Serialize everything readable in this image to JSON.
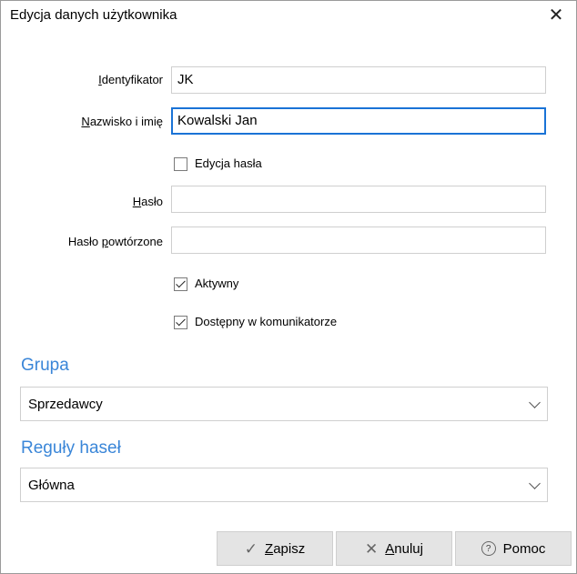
{
  "window": {
    "title": "Edycja danych użytkownika",
    "close_glyph": "✕"
  },
  "fields": {
    "identifier": {
      "label_u": "I",
      "label_rest": "dentyfikator",
      "value": "JK"
    },
    "name": {
      "label_u": "N",
      "label_rest": "azwisko i imię",
      "value": "Kowalski Jan"
    },
    "edit_password": {
      "label": "Edycja hasła",
      "checked": false
    },
    "password": {
      "label_u": "H",
      "label_rest": "asło",
      "value": ""
    },
    "password_repeat": {
      "label_pre": "Hasło ",
      "label_u": "p",
      "label_rest": "owtórzone",
      "value": ""
    },
    "active": {
      "label": "Aktywny",
      "checked": true
    },
    "messenger": {
      "label": "Dostępny w komunikatorze",
      "checked": true
    }
  },
  "group": {
    "header": "Grupa",
    "selected": "Sprzedawcy"
  },
  "password_rules": {
    "header": "Reguły haseł",
    "selected": "Główna"
  },
  "buttons": {
    "save": {
      "icon": "check-icon",
      "glyph": "✓",
      "label_u": "Z",
      "label_rest": "apisz"
    },
    "cancel": {
      "icon": "close-icon",
      "glyph": "✕",
      "label_u": "A",
      "label_rest": "nuluj"
    },
    "help": {
      "icon": "question-circle-icon",
      "glyph": "?",
      "label": "Pomoc"
    }
  },
  "colors": {
    "accent": "#3a86d8",
    "focus_border": "#1a73d6",
    "button_bg": "#e4e4e4"
  }
}
